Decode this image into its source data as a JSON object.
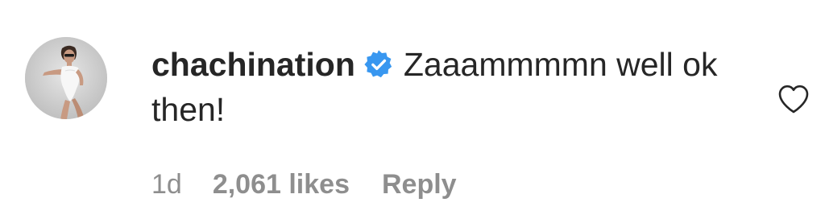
{
  "comment": {
    "username": "chachination",
    "verified_icon": "verified-badge-icon",
    "text": "Zaaammmmn well ok then!",
    "age": "1d",
    "likes": "2,061 likes",
    "reply_label": "Reply",
    "like_icon": "heart-outline-icon"
  },
  "colors": {
    "text": "#262626",
    "meta": "#8e8e8e",
    "verified": "#3897f0",
    "background": "#ffffff"
  }
}
